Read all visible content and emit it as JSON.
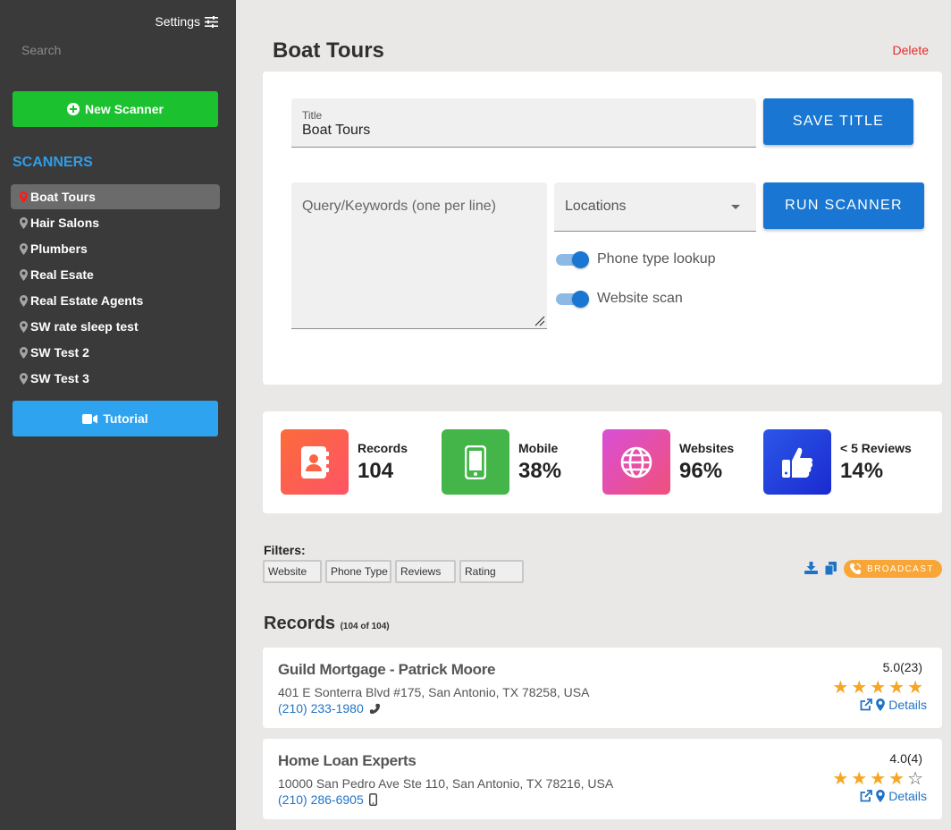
{
  "sidebar": {
    "settings_label": "Settings",
    "search_placeholder": "Search",
    "new_scanner_label": "New Scanner",
    "scanners_heading": "SCANNERS",
    "items": [
      {
        "label": "Boat Tours",
        "active": true
      },
      {
        "label": "Hair Salons"
      },
      {
        "label": "Plumbers"
      },
      {
        "label": "Real Esate"
      },
      {
        "label": "Real Estate Agents"
      },
      {
        "label": "SW rate sleep test"
      },
      {
        "label": "SW Test 2"
      },
      {
        "label": "SW Test 3"
      }
    ],
    "tutorial_label": "Tutorial"
  },
  "header": {
    "title": "Boat Tours",
    "delete_label": "Delete"
  },
  "form": {
    "title_label": "Title",
    "title_value": "Boat Tours",
    "save_label": "SAVE TITLE",
    "query_placeholder": "Query/Keywords (one per line)",
    "locations_label": "Locations",
    "run_label": "RUN SCANNER",
    "toggles": [
      {
        "label": "Phone type lookup",
        "on": true
      },
      {
        "label": "Website scan",
        "on": true
      }
    ]
  },
  "stats": [
    {
      "label": "Records",
      "value": "104",
      "icon": "address-book-icon"
    },
    {
      "label": "Mobile",
      "value": "38%",
      "icon": "mobile-icon"
    },
    {
      "label": "Websites",
      "value": "96%",
      "icon": "globe-icon"
    },
    {
      "label": "< 5 Reviews",
      "value": "14%",
      "icon": "thumbs-up-icon"
    }
  ],
  "filters": {
    "label": "Filters:",
    "buttons": [
      "Website",
      "Phone Type",
      "Reviews",
      "Rating"
    ],
    "broadcast_label": "BROADCAST"
  },
  "records": {
    "heading": "Records",
    "count_text": "(104 of 104)",
    "items": [
      {
        "name": "Guild Mortgage - Patrick Moore",
        "address": "401 E Sonterra Blvd #175, San Antonio, TX 78258, USA",
        "phone": "(210) 233-1980",
        "phone_type": "landline",
        "rating": "5.0(23)",
        "stars": 5,
        "details_label": "Details"
      },
      {
        "name": "Home Loan Experts",
        "address": "10000 San Pedro Ave Ste 110, San Antonio, TX 78216, USA",
        "phone": "(210) 286-6905",
        "phone_type": "mobile",
        "rating": "4.0(4)",
        "stars": 4,
        "details_label": "Details"
      }
    ]
  },
  "colors": {
    "sidebar_bg": "#3a3a3a",
    "new_scanner": "#1bc12e",
    "tutorial": "#2ea3f0",
    "primary": "#1976d2",
    "delete": "#e52b2b",
    "broadcast": "#f8a637",
    "star": "#f5a623"
  }
}
